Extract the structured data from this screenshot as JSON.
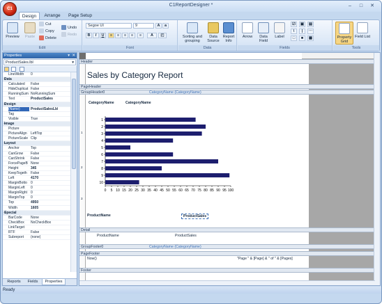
{
  "app": {
    "title": "C1ReportDesigner *",
    "logo": "C1"
  },
  "tabs": [
    {
      "label": "Design",
      "active": true
    },
    {
      "label": "Arrange",
      "active": false
    },
    {
      "label": "Page Setup",
      "active": false
    }
  ],
  "ribbon": {
    "edit": {
      "label": "Edit",
      "preview": "Preview",
      "paste": "Paste",
      "cut": "Cut",
      "copy": "Copy",
      "delete": "Delete",
      "undo": "Undo",
      "redo": "Redo"
    },
    "font": {
      "label": "Font",
      "family": "Segoe UI",
      "size": "9",
      "bold": "B",
      "italic": "I",
      "underline": "U",
      "font_color": "A"
    },
    "data": {
      "label": "Data",
      "sorting": "Sorting and grouping",
      "data_source": "Data Source",
      "report_info": "Report Info"
    },
    "fields": {
      "label": "Fields",
      "arrow": "Arrow",
      "data_field": "Data Field",
      "label_btn": "Label"
    },
    "tools": {
      "label": "Tools",
      "property_grid": "Property Grid",
      "field_list": "Field List"
    }
  },
  "properties": {
    "header": "Properties",
    "selected_object": "ProductSales.lbl",
    "rows": [
      {
        "name": "LineWidth",
        "value": "0"
      },
      {
        "name": "Data",
        "cat": true
      },
      {
        "name": "Calculated",
        "value": "False"
      },
      {
        "name": "HideDuplicat",
        "value": "False"
      },
      {
        "name": "RunningSum",
        "value": "NoRunningSum"
      },
      {
        "name": "Text",
        "value": "ProductSales",
        "bold": true
      },
      {
        "name": "Design",
        "cat": true
      },
      {
        "name": "(Name)",
        "value": "ProductSalesLbl",
        "selected": true,
        "bold": true
      },
      {
        "name": "Tag",
        "value": ""
      },
      {
        "name": "Visible",
        "value": "True"
      },
      {
        "name": "Image",
        "cat": true
      },
      {
        "name": "Picture",
        "value": ""
      },
      {
        "name": "PictureAlign",
        "value": "LeftTop"
      },
      {
        "name": "PictureScale",
        "value": "Clip"
      },
      {
        "name": "Layout",
        "cat": true
      },
      {
        "name": "Anchor",
        "value": "Top"
      },
      {
        "name": "CanGrow",
        "value": "False"
      },
      {
        "name": "CanShrink",
        "value": "False"
      },
      {
        "name": "ForcePageB",
        "value": "None"
      },
      {
        "name": "Height",
        "value": "345",
        "bold": true
      },
      {
        "name": "KeepTogeth",
        "value": "False"
      },
      {
        "name": "Left",
        "value": "4170",
        "bold": true
      },
      {
        "name": "MarginBotto",
        "value": "0"
      },
      {
        "name": "MarginLeft",
        "value": "0"
      },
      {
        "name": "MarginRight",
        "value": "0"
      },
      {
        "name": "MarginTop",
        "value": "0"
      },
      {
        "name": "Top",
        "value": "4950",
        "bold": true
      },
      {
        "name": "Width",
        "value": "1605",
        "bold": true
      },
      {
        "name": "Special",
        "cat": true
      },
      {
        "name": "BarCode",
        "value": "None"
      },
      {
        "name": "CheckBox",
        "value": "NoCheckBox"
      },
      {
        "name": "LinkTarget",
        "value": ""
      },
      {
        "name": "RTF",
        "value": "False"
      },
      {
        "name": "Subreport",
        "value": "(none)"
      }
    ],
    "bottom_tabs": [
      {
        "label": "Reports"
      },
      {
        "label": "Fields"
      },
      {
        "label": "Properties",
        "active": true
      }
    ]
  },
  "report": {
    "bands": {
      "header": "Header",
      "page_header": "PageHeader",
      "group_header": "GroupHeader0",
      "group_header_label": "CategoryName (CategoryName)",
      "detail": "Detail",
      "group_footer": "GroupFooter0",
      "group_footer_label": "CategoryName (CategoryName)",
      "page_footer": "PageFooter",
      "footer": "Footer"
    },
    "title": "Sales by Category Report",
    "category_label": "CategoryName",
    "category_field": "CategoryName",
    "product_name_label": "ProductName",
    "product_sales_label": "ProductSales",
    "detail_product_name": "ProductName",
    "detail_product_sales": "ProductSales",
    "page_footer_now": "Now()",
    "page_footer_expr": "\"Page \" & [Page] & \" of \" & [Pages]",
    "vruler": [
      "1",
      "2",
      "3"
    ]
  },
  "chart_data": {
    "type": "bar",
    "orientation": "horizontal",
    "categories": [
      "1",
      "2",
      "3",
      "4",
      "5",
      "6",
      "7",
      "8",
      "9",
      "10"
    ],
    "values": [
      72,
      80,
      77,
      54,
      20,
      54,
      90,
      45,
      99,
      27
    ],
    "xticks": [
      0,
      5,
      10,
      15,
      20,
      25,
      30,
      35,
      40,
      45,
      50,
      55,
      60,
      65,
      70,
      75,
      80,
      85,
      90,
      95,
      100
    ],
    "xlim": [
      0,
      100
    ],
    "bar_color": "#1d1e6e"
  },
  "status": "Ready"
}
